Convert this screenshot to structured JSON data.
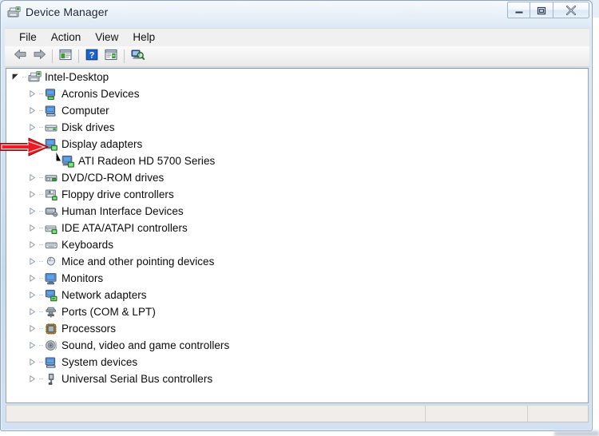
{
  "window": {
    "title": "Device Manager",
    "title_icon": "device-manager-icon",
    "controls": {
      "minimize": "Minimize",
      "restore": "Restore Down",
      "close": "Close"
    }
  },
  "menubar": {
    "items": [
      {
        "label": "File",
        "name": "menu-file"
      },
      {
        "label": "Action",
        "name": "menu-action"
      },
      {
        "label": "View",
        "name": "menu-view"
      },
      {
        "label": "Help",
        "name": "menu-help"
      }
    ]
  },
  "toolbar": {
    "buttons": [
      {
        "name": "back-button",
        "icon": "back-arrow-icon",
        "tooltip": "Back"
      },
      {
        "name": "forward-button",
        "icon": "forward-arrow-icon",
        "tooltip": "Forward"
      },
      {
        "name": "show-hide-console-tree-button",
        "icon": "console-tree-icon",
        "tooltip": "Show/Hide Console Tree"
      },
      {
        "name": "help-button",
        "icon": "help-question-icon",
        "tooltip": "Help"
      },
      {
        "name": "properties-button",
        "icon": "properties-icon",
        "tooltip": "Properties"
      },
      {
        "name": "scan-for-hardware-changes-button",
        "icon": "scan-hardware-icon",
        "tooltip": "Scan for hardware changes"
      }
    ]
  },
  "tree": {
    "root": {
      "label": "Intel-Desktop",
      "icon": "computer-root-icon",
      "state": "expanded",
      "indent": 0
    },
    "nodes": [
      {
        "label": "Acronis Devices",
        "icon": "acronis-device-icon",
        "state": "collapsed",
        "indent": 1
      },
      {
        "label": "Computer",
        "icon": "computer-icon",
        "state": "collapsed",
        "indent": 1
      },
      {
        "label": "Disk drives",
        "icon": "disk-drive-icon",
        "state": "collapsed",
        "indent": 1
      },
      {
        "label": "Display adapters",
        "icon": "display-adapter-icon",
        "state": "expanded",
        "indent": 1,
        "highlighted": true
      },
      {
        "label": "ATI Radeon HD 5700 Series",
        "icon": "display-adapter-icon",
        "state": "leaf",
        "indent": 2
      },
      {
        "label": "DVD/CD-ROM drives",
        "icon": "dvd-drive-icon",
        "state": "collapsed",
        "indent": 1
      },
      {
        "label": "Floppy drive controllers",
        "icon": "floppy-controller-icon",
        "state": "collapsed",
        "indent": 1
      },
      {
        "label": "Human Interface Devices",
        "icon": "hid-icon",
        "state": "collapsed",
        "indent": 1
      },
      {
        "label": "IDE ATA/ATAPI controllers",
        "icon": "ide-controller-icon",
        "state": "collapsed",
        "indent": 1
      },
      {
        "label": "Keyboards",
        "icon": "keyboard-icon",
        "state": "collapsed",
        "indent": 1
      },
      {
        "label": "Mice and other pointing devices",
        "icon": "mouse-icon",
        "state": "collapsed",
        "indent": 1
      },
      {
        "label": "Monitors",
        "icon": "monitor-icon",
        "state": "collapsed",
        "indent": 1
      },
      {
        "label": "Network adapters",
        "icon": "network-adapter-icon",
        "state": "collapsed",
        "indent": 1
      },
      {
        "label": "Ports (COM & LPT)",
        "icon": "port-icon",
        "state": "collapsed",
        "indent": 1
      },
      {
        "label": "Processors",
        "icon": "processor-icon",
        "state": "collapsed",
        "indent": 1
      },
      {
        "label": "Sound, video and game controllers",
        "icon": "sound-controller-icon",
        "state": "collapsed",
        "indent": 1
      },
      {
        "label": "System devices",
        "icon": "system-device-icon",
        "state": "collapsed",
        "indent": 1
      },
      {
        "label": "Universal Serial Bus controllers",
        "icon": "usb-controller-icon",
        "state": "collapsed",
        "indent": 1
      }
    ]
  },
  "statusbar": {
    "panes": [
      "",
      "",
      ""
    ]
  },
  "annotation": {
    "arrow": {
      "name": "red-pointer-arrow",
      "color": "#e50914",
      "points_to": "Display adapters"
    }
  },
  "colors": {
    "accent": "#e50914",
    "window_frame": "#8ea6c0",
    "tree_background": "#ffffff",
    "toolbar_background": "#f2f2f2",
    "statusbar_background": "#f0edeb",
    "text": "#0a0a0a"
  }
}
